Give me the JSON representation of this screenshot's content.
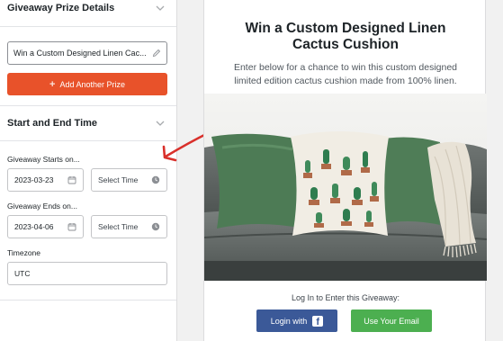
{
  "sidebar": {
    "prize_section_title": "Giveaway Prize Details",
    "prize_value": "Win a Custom Designed Linen Cac...",
    "add_prize_label": "Add Another Prize",
    "time_section_title": "Start and End Time",
    "starts_label": "Giveaway Starts on...",
    "start_date": "2023-03-23",
    "start_time_placeholder": "Select Time",
    "ends_label": "Giveaway Ends on...",
    "end_date": "2023-04-06",
    "end_time_placeholder": "Select Time",
    "timezone_label": "Timezone",
    "timezone_value": "UTC"
  },
  "preview": {
    "title": "Win a Custom Designed Linen Cactus Cushion",
    "description": "Enter below for a chance to win this custom designed limited edition cactus cushion made from 100% linen.",
    "login_prompt": "Log In to Enter this Giveaway:",
    "facebook_button": "Login with",
    "email_button": "Use Your Email"
  },
  "colors": {
    "accent_orange": "#e8522a",
    "facebook_blue": "#3b5998",
    "email_green": "#4caf50",
    "arrow_red": "#d9302b"
  },
  "icons": [
    "chevron-down-icon",
    "pencil-icon",
    "plus-icon",
    "calendar-icon",
    "clock-icon",
    "facebook-icon",
    "arrow-annotation"
  ]
}
